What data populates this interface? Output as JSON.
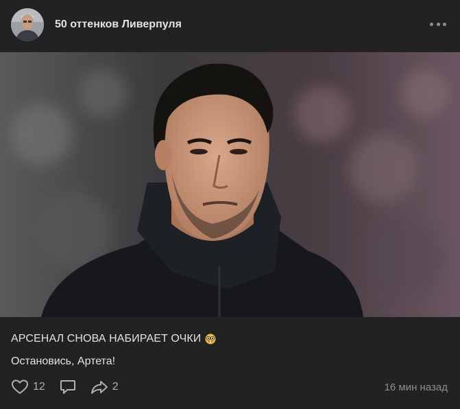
{
  "post": {
    "group_name": "50 оттенков Ливерпуля",
    "headline": "АРСЕНАЛ СНОВА НАБИРАЕТ ОЧКИ",
    "headline_emoji": "nerd-face-emoji",
    "body": "Остановись, Артета!",
    "likes": "12",
    "reposts": "2",
    "time": "16 мин назад"
  },
  "icons": {
    "more": "more-horizontal-icon",
    "like": "heart-icon",
    "comment": "comment-icon",
    "share": "share-arrow-icon"
  },
  "colors": {
    "background": "#222222",
    "text_primary": "#e1e3e6",
    "text_secondary": "#8b8f94"
  }
}
